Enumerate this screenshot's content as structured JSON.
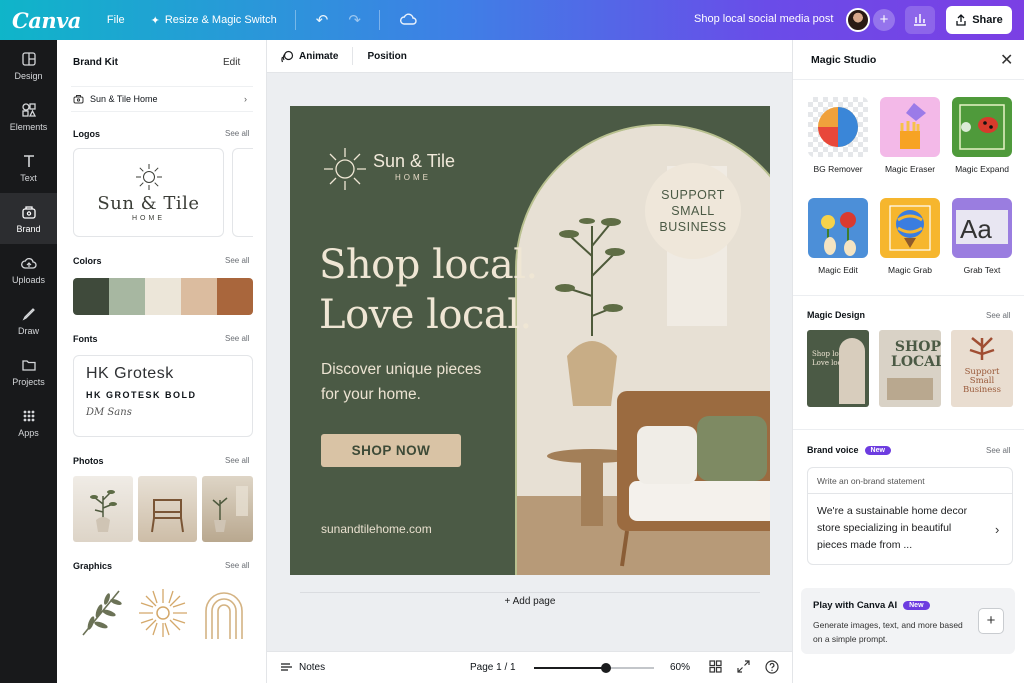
{
  "topbar": {
    "logo": "Canva",
    "file": "File",
    "resize": "Resize & Magic Switch",
    "doc_title": "Shop local social media post",
    "share": "Share"
  },
  "rail": [
    {
      "label": "Design",
      "icon": "design-icon"
    },
    {
      "label": "Elements",
      "icon": "elements-icon"
    },
    {
      "label": "Text",
      "icon": "text-icon"
    },
    {
      "label": "Brand",
      "icon": "brand-icon"
    },
    {
      "label": "Uploads",
      "icon": "uploads-icon"
    },
    {
      "label": "Draw",
      "icon": "draw-icon"
    },
    {
      "label": "Projects",
      "icon": "projects-icon"
    },
    {
      "label": "Apps",
      "icon": "apps-icon"
    }
  ],
  "brand_panel": {
    "title": "Brand Kit",
    "edit": "Edit",
    "kit_name": "Sun & Tile Home",
    "logos": "Logos",
    "colors": "Colors",
    "fonts": "Fonts",
    "photos": "Photos",
    "graphics": "Graphics",
    "see_all": "See all",
    "logo_name": "Sun & Tile",
    "logo_sub": "HOME",
    "palette": [
      "#3f4a3b",
      "#a7b7a1",
      "#ece6d9",
      "#dbbc9f",
      "#a9663c"
    ],
    "font_1": "HK Grotesk",
    "font_2": "HK GROTESK BOLD",
    "font_3": "DM Sans"
  },
  "canvas_toolbar": {
    "animate": "Animate",
    "position": "Position"
  },
  "design": {
    "logo_name": "Sun & Tile",
    "logo_sub": "HOME",
    "headline_1": "Shop local.",
    "headline_2": "Love local.",
    "body_1": "Discover unique pieces",
    "body_2": "for your home.",
    "cta": "SHOP NOW",
    "url": "sunandtilehome.com",
    "badge_1": "SUPPORT",
    "badge_2": "SMALL",
    "badge_3": "BUSINESS",
    "bg_color": "#4b5a45"
  },
  "add_page": "+ Add page",
  "bottombar": {
    "notes": "Notes",
    "page": "Page 1 / 1",
    "zoom": "60%",
    "zoom_value": 0.6
  },
  "magic_studio": {
    "title": "Magic Studio",
    "tools": [
      {
        "label": "BG Remover"
      },
      {
        "label": "Magic Eraser"
      },
      {
        "label": "Magic Expand"
      },
      {
        "label": "Magic Edit"
      },
      {
        "label": "Magic Grab"
      },
      {
        "label": "Grab Text"
      }
    ],
    "magic_design": "Magic Design",
    "see_all": "See all",
    "md_thumbs": [
      {
        "line1": "Shop local.",
        "line2": "Love local."
      },
      {
        "line1": "SHOP",
        "line2": "LOCAL"
      },
      {
        "line1": "Support",
        "line2": "Small",
        "line3": "Business"
      }
    ],
    "brand_voice": "Brand voice",
    "new_badge": "New",
    "bv_prompt": "Write an on-brand statement",
    "bv_text": "We're a sustainable home decor store specializing in beautiful pieces made from ...",
    "ai_title": "Play with Canva AI",
    "ai_desc": "Generate images, text, and more based on a simple prompt."
  }
}
